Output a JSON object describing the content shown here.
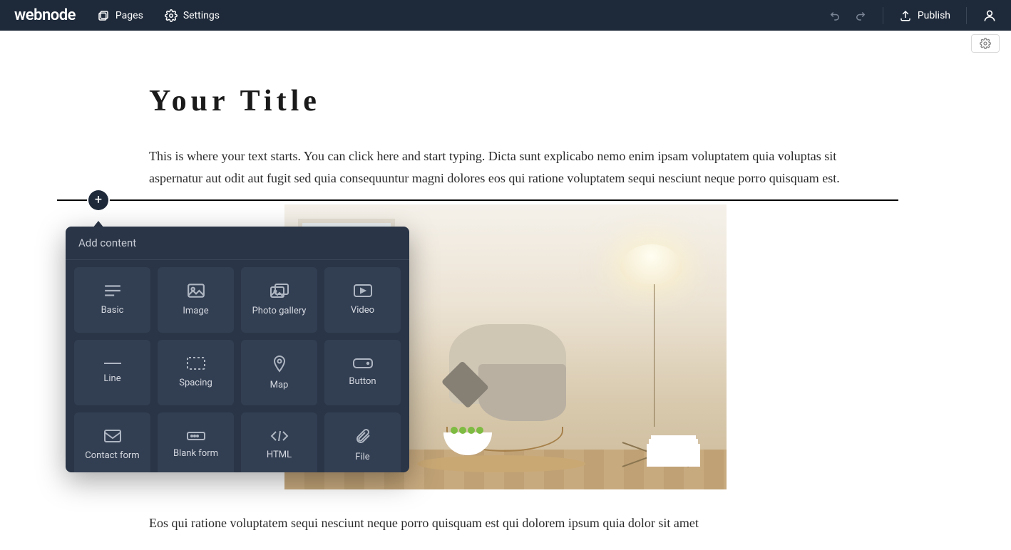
{
  "brand": "webnode",
  "topbar": {
    "pages": "Pages",
    "settings": "Settings",
    "publish": "Publish"
  },
  "page": {
    "title": "Your Title",
    "paragraph1": "This is where your text starts. You can click here and start typing. Dicta sunt explicabo nemo enim ipsam voluptatem quia voluptas sit aspernatur aut odit aut fugit sed quia consequuntur magni dolores eos qui ratione voluptatem sequi nesciunt neque porro quisquam est.",
    "paragraph2": "Eos qui ratione voluptatem sequi nesciunt neque porro quisquam est qui dolorem ipsum quia dolor sit amet"
  },
  "popover": {
    "title": "Add content",
    "tiles": [
      {
        "label": "Basic"
      },
      {
        "label": "Image"
      },
      {
        "label": "Photo gallery"
      },
      {
        "label": "Video"
      },
      {
        "label": "Line"
      },
      {
        "label": "Spacing"
      },
      {
        "label": "Map"
      },
      {
        "label": "Button"
      },
      {
        "label": "Contact form"
      },
      {
        "label": "Blank form"
      },
      {
        "label": "HTML"
      },
      {
        "label": "File"
      }
    ]
  }
}
